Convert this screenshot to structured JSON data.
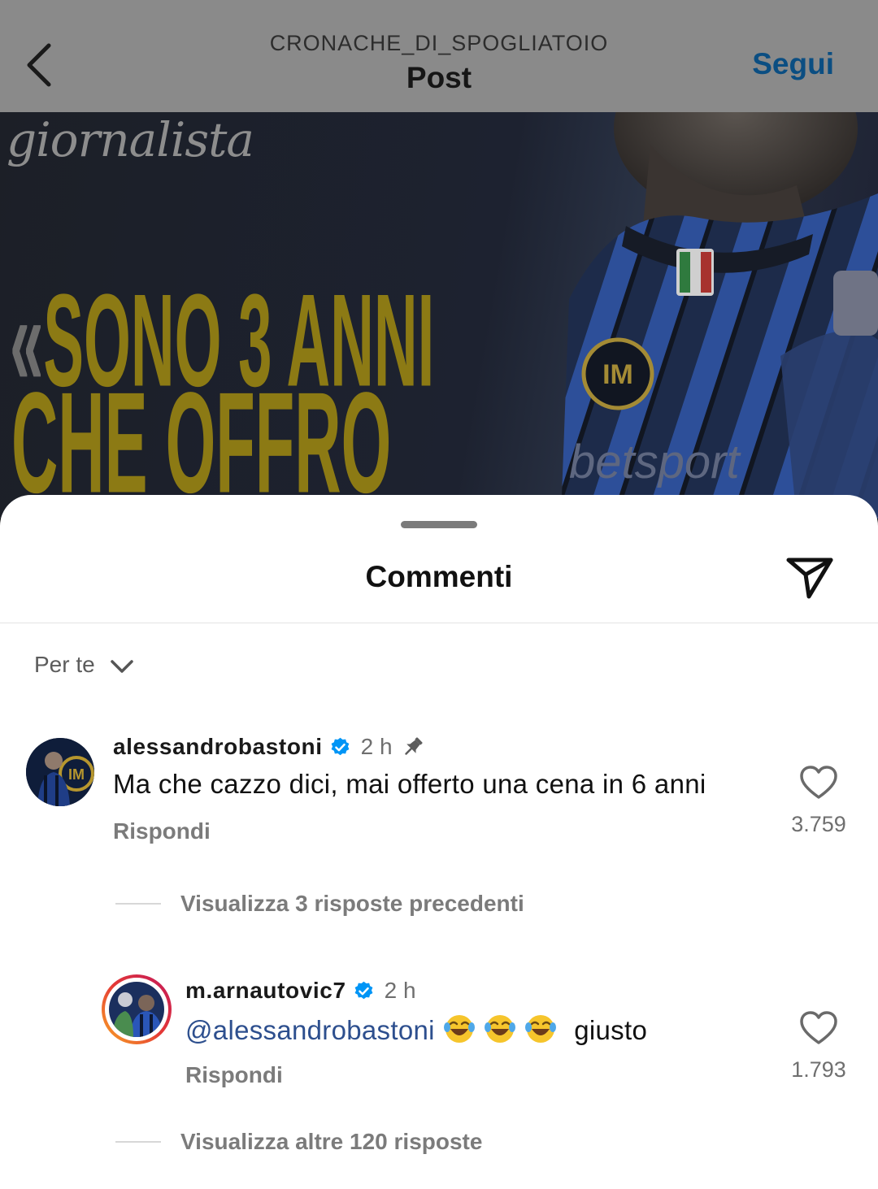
{
  "header": {
    "account": "CRONACHE_DI_SPOGLIATOIO",
    "title": "Post",
    "follow_label": "Segui"
  },
  "post_image": {
    "overlay_word": "giornalista",
    "quote_open": "«",
    "headline_line1": "SONO 3 ANNI",
    "headline_line2": "CHE OFFRO"
  },
  "sheet": {
    "title": "Commenti",
    "sort_label": "Per te"
  },
  "comments": [
    {
      "username": "alessandrobastoni",
      "verified": true,
      "time": "2 h",
      "pinned": true,
      "text": "Ma che cazzo dici, mai offerto una cena in 6 anni",
      "reply_label": "Rispondi",
      "likes": "3.759",
      "thread_link": "Visualizza 3 risposte precedenti"
    },
    {
      "username": "m.arnautovic7",
      "verified": true,
      "time": "2 h",
      "mention": "@alessandrobastoni",
      "emojis": [
        "face-with-tears-of-joy",
        "face-with-tears-of-joy",
        "face-with-tears-of-joy"
      ],
      "text_after": "giusto",
      "reply_label": "Rispondi",
      "likes": "1.793",
      "thread_link": "Visualizza altre 120 risposte"
    }
  ],
  "colors": {
    "verified": "#0095f6",
    "mention": "#2d4f8e",
    "headline": "#8c7a14",
    "story_ring_start": "#f9a825",
    "story_ring_end": "#c2185b"
  }
}
